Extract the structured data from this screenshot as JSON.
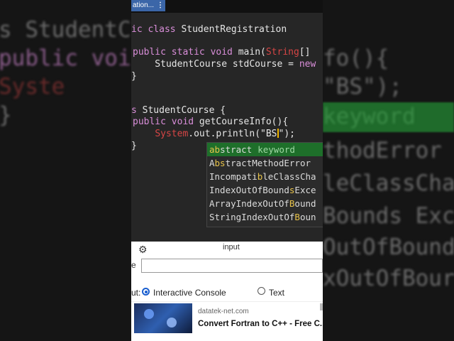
{
  "tab": {
    "label": "ation...",
    "menu": "⋮"
  },
  "code": [
    {
      "parts": [
        {
          "t": "ic class ",
          "c": "kw"
        },
        {
          "t": "StudentRegistration",
          "c": ""
        }
      ]
    },
    {
      "parts": []
    },
    {
      "parts": [
        {
          "t": "public static void ",
          "c": "kw"
        },
        {
          "t": "main(",
          "c": ""
        },
        {
          "t": "String",
          "c": "err"
        },
        {
          "t": "[]",
          "c": ""
        }
      ]
    },
    {
      "parts": [
        {
          "t": "    StudentCourse stdCourse = ",
          "c": ""
        },
        {
          "t": "new",
          "c": "kw"
        }
      ]
    },
    {
      "parts": [
        {
          "t": "}",
          "c": ""
        }
      ]
    },
    {
      "parts": []
    },
    {
      "parts": []
    },
    {
      "parts": [
        {
          "t": "s ",
          "c": "kw"
        },
        {
          "t": "StudentCourse {",
          "c": ""
        }
      ]
    },
    {
      "parts": [
        {
          "t": "public void ",
          "c": "kw"
        },
        {
          "t": "getCourseInfo(){",
          "c": ""
        }
      ]
    },
    {
      "parts": [
        {
          "t": "    ",
          "c": ""
        },
        {
          "t": "System",
          "c": "err"
        },
        {
          "t": ".out.println(\"BS",
          "c": ""
        },
        {
          "t": "CURSOR",
          "c": "cursor"
        },
        {
          "t": "\");",
          "c": ""
        }
      ]
    },
    {
      "parts": [
        {
          "t": "}",
          "c": ""
        }
      ]
    }
  ],
  "autocomplete": [
    {
      "pre": "",
      "m": "ab",
      "post": "stract",
      "hint": "keyword",
      "selected": true
    },
    {
      "pre": "A",
      "m": "bs",
      "post": "tractMethodError",
      "hint": ""
    },
    {
      "pre": "Incompati",
      "m": "b",
      "post": "leClassCha",
      "hint": ""
    },
    {
      "pre": "IndexOutOfBound",
      "m": "s",
      "post": "Exce",
      "hint": ""
    },
    {
      "pre": "ArrayIndexOutOf",
      "m": "B",
      "post": "ound",
      "hint": ""
    },
    {
      "pre": "StringIndexOutOf",
      "m": "B",
      "post": "oun",
      "hint": ""
    }
  ],
  "panel": {
    "title": "input",
    "stdin_label": "e",
    "io_label": "ut:",
    "options": [
      {
        "label": "Interactive Console",
        "checked": true
      },
      {
        "label": "Text",
        "checked": false
      }
    ]
  },
  "ad": {
    "domain": "datatek-net.com",
    "title": "Convert Fortran to C++ - Free C..."
  },
  "background": {
    "left_lines": [
      "s StudentC",
      " public voi",
      "     Syste",
      " }"
    ],
    "right_lines": [
      "fo(){",
      "\"BS\");",
      "keyword",
      "thodError",
      "leClassCha",
      "Bounds Exce",
      "OutOfBound",
      "xOutOfBour"
    ]
  },
  "colors": {
    "keyword": "#d98ed9",
    "error": "#d64545",
    "selection": "#1e6f2a",
    "match": "#e9c44b",
    "tab": "#3b66a8",
    "radio": "#1a5fd0"
  }
}
